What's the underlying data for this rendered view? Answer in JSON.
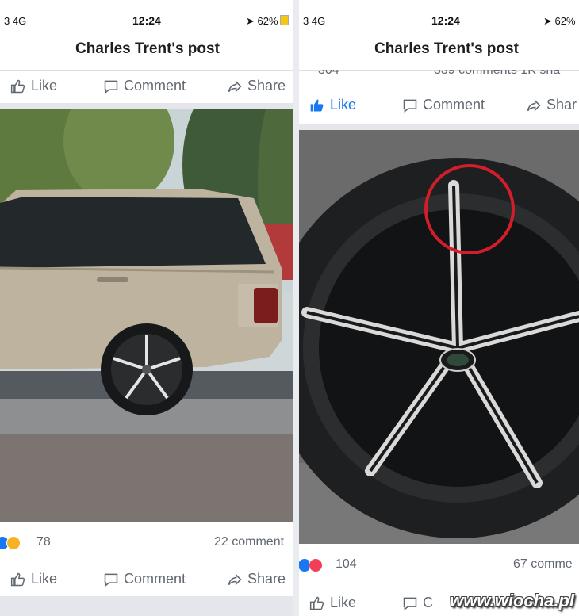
{
  "left": {
    "status": {
      "carrier": "3  4G",
      "time": "12:24",
      "battery": "62%"
    },
    "title": "Charles Trent's post",
    "actions_top": {
      "like": "Like",
      "comment": "Comment",
      "share": "Share"
    },
    "reaction_count": "78",
    "comment_count": "22 comment",
    "actions_bottom": {
      "like": "Like",
      "comment": "Comment",
      "share": "Share"
    }
  },
  "right": {
    "status": {
      "carrier": "3  4G",
      "time": "12:24",
      "battery": "62%"
    },
    "title": "Charles Trent's post",
    "cutoff_left": "304",
    "cutoff_right": "339 comments   1K sha",
    "actions": {
      "like": "Like",
      "comment": "Comment",
      "share": "Shar"
    },
    "reaction_count": "104",
    "comment_count": "67 comme",
    "bottom_like": "Like",
    "bottom_comment": "C"
  },
  "watermark": "www.wiocha.pl",
  "colors": {
    "like_blue": "#1877f2",
    "gray_text": "#606770"
  }
}
